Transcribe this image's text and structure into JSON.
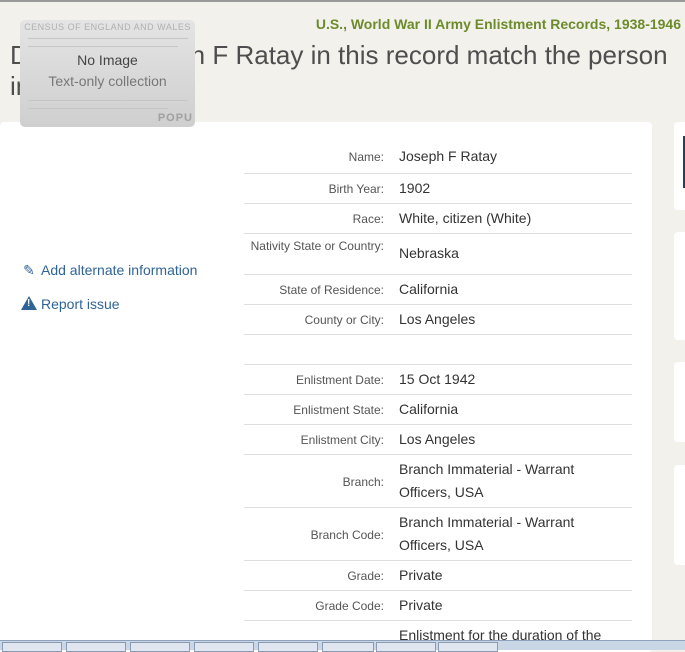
{
  "collection_title": "U.S., World War II Army Enlistment Records, 1938-1946",
  "headline": "Does the Joseph F Ratay in this record match the person in your tree?",
  "thumbnail": {
    "census_text": "CENSUS OF ENGLAND AND WALES",
    "no_image": "No Image",
    "subtitle": "Text-only collection",
    "popu_text": "POPU"
  },
  "links": {
    "add_alternate": "Add alternate information",
    "report_issue": "Report issue"
  },
  "record": [
    {
      "label": "Name:",
      "value": "Joseph F Ratay"
    },
    {
      "label": "Birth Year:",
      "value": "1902"
    },
    {
      "label": "Race:",
      "value": "White, citizen (White)"
    },
    {
      "label": "Nativity State or Country:",
      "value": "Nebraska"
    },
    {
      "label": "State of Residence:",
      "value": "California"
    },
    {
      "label": "County or City:",
      "value": "Los Angeles"
    },
    {
      "label": "",
      "value": ""
    },
    {
      "label": "Enlistment Date:",
      "value": "15 Oct 1942"
    },
    {
      "label": "Enlistment State:",
      "value": "California"
    },
    {
      "label": "Enlistment City:",
      "value": "Los Angeles"
    },
    {
      "label": "Branch:",
      "value": "Branch Immaterial - Warrant Officers, USA"
    },
    {
      "label": "Branch Code:",
      "value": "Branch Immaterial - Warrant Officers, USA"
    },
    {
      "label": "Grade:",
      "value": "Private"
    },
    {
      "label": "Grade Code:",
      "value": "Private"
    },
    {
      "label": "",
      "value": "Enlistment for the duration of the"
    }
  ],
  "colors": {
    "collection_green": "#6d8b2b",
    "link_blue": "#2f6497",
    "page_bg": "#f3f1ec"
  }
}
